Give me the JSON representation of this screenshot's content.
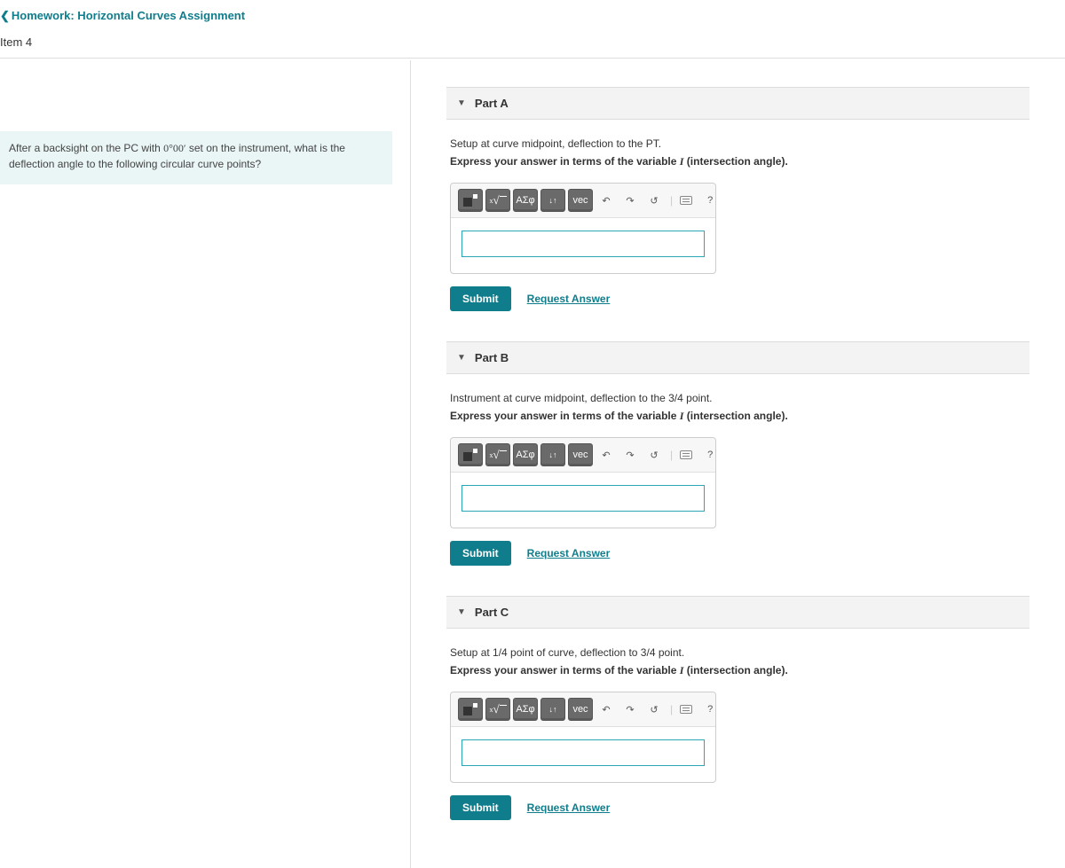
{
  "breadcrumb": {
    "label": "Homework: Horizontal Curves Assignment"
  },
  "item_header": "Item 4",
  "question": {
    "text_before": "After a backsight on the PC with ",
    "angle": "0°00′",
    "text_after": " set on the instrument, what is the deflection angle to the following circular curve points?"
  },
  "toolbar_labels": {
    "templates": "",
    "xroot": "x√",
    "greek": "ΑΣφ",
    "subscript": "↓↑",
    "vec": "vec",
    "undo": "↶",
    "redo": "↷",
    "reset": "↺",
    "keyboard": "",
    "help": "?"
  },
  "submit_label": "Submit",
  "request_label": "Request Answer",
  "parts": [
    {
      "id": "A",
      "title": "Part A",
      "desc": "Setup at curve midpoint, deflection to the PT.",
      "instruction_before": "Express your answer in terms of the variable ",
      "instruction_var": "I",
      "instruction_after": " (intersection angle).",
      "value": ""
    },
    {
      "id": "B",
      "title": "Part B",
      "desc": "Instrument at curve midpoint, deflection to the 3/4 point.",
      "instruction_before": "Express your answer in terms of the variable ",
      "instruction_var": "I",
      "instruction_after": " (intersection angle).",
      "value": ""
    },
    {
      "id": "C",
      "title": "Part C",
      "desc": "Setup at 1/4 point of curve, deflection to 3/4 point.",
      "instruction_before": "Express your answer in terms of the variable ",
      "instruction_var": "I",
      "instruction_after": " (intersection angle).",
      "value": ""
    }
  ]
}
